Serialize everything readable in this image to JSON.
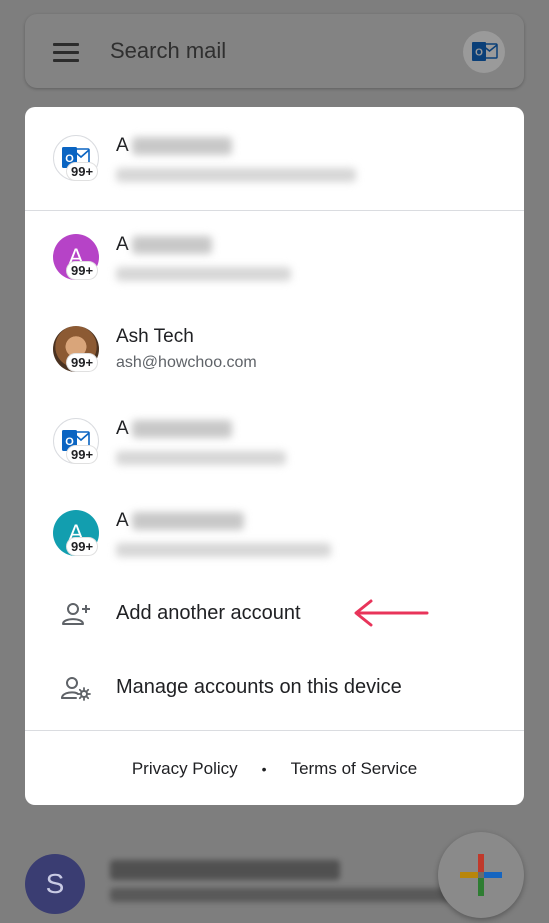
{
  "search": {
    "placeholder": "Search mail"
  },
  "accounts": [
    {
      "initial_visible": "A",
      "avatar": "outlook-icon",
      "badge": "99+"
    },
    {
      "initial_visible": "A",
      "avatar_letter": "A",
      "avatar_color": "#b643c7",
      "badge": "99+"
    },
    {
      "name": "Ash Tech",
      "email": "ash@howchoo.com",
      "avatar": "photo",
      "badge": "99+"
    },
    {
      "initial_visible": "A",
      "avatar": "outlook-icon",
      "badge": "99+"
    },
    {
      "initial_visible": "A",
      "avatar_letter": "A",
      "avatar_color": "#129eaf",
      "badge": "99+"
    }
  ],
  "actions": {
    "add_account": "Add another account",
    "manage_accounts": "Manage accounts on this device"
  },
  "footer": {
    "privacy": "Privacy Policy",
    "separator": "•",
    "terms": "Terms of Service"
  },
  "background": {
    "avatar_letter": "S"
  },
  "colors": {
    "arrow": "#e8345a",
    "outlook_blue": "#0a64c2",
    "dialog_bg": "#ffffff",
    "scrim": "#7e7e7e"
  }
}
